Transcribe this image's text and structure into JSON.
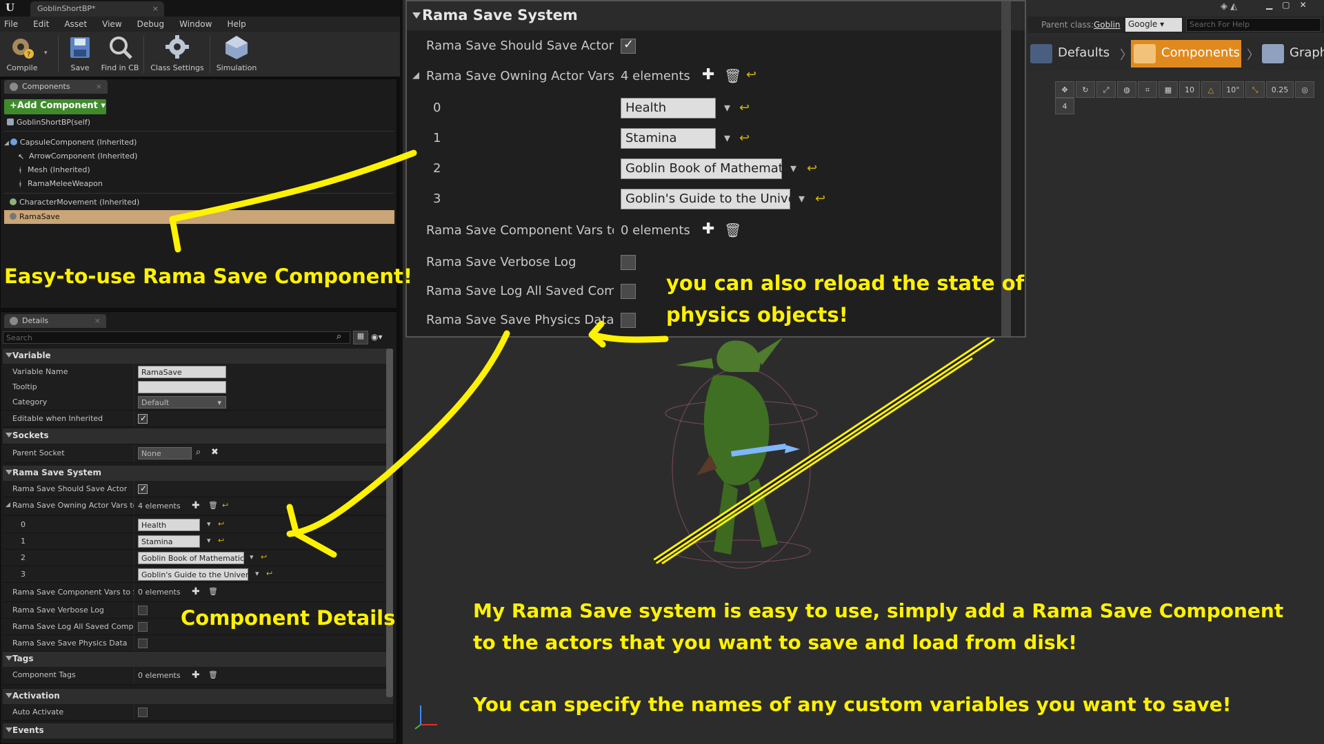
{
  "window": {
    "tab_title": "GoblinShortBP*",
    "logo": "U"
  },
  "menu": [
    "File",
    "Edit",
    "Asset",
    "View",
    "Debug",
    "Window",
    "Help"
  ],
  "toolbar": [
    {
      "label": "Compile",
      "icon": "compile-icon"
    },
    {
      "label": "Save",
      "icon": "save-icon"
    },
    {
      "label": "Find in CB",
      "icon": "find-icon"
    },
    {
      "label": "Class Settings",
      "icon": "gear-icon"
    },
    {
      "label": "Simulation",
      "icon": "simulation-icon"
    }
  ],
  "components_panel": {
    "tab": "Components",
    "add_button": "+Add Component ▾",
    "self": "GoblinShortBP(self)",
    "tree": [
      {
        "label": "CapsuleComponent (Inherited)",
        "indent": 0
      },
      {
        "label": "ArrowComponent (Inherited)",
        "indent": 1
      },
      {
        "label": "Mesh (Inherited)",
        "indent": 1
      },
      {
        "label": "RamaMeleeWeapon",
        "indent": 1
      },
      {
        "label": "CharacterMovement (Inherited)",
        "indent": 0
      },
      {
        "label": "RamaSave",
        "indent": 0,
        "selected": true
      }
    ]
  },
  "details_panel": {
    "tab": "Details",
    "search_placeholder": "Search",
    "variable": {
      "header": "Variable",
      "name_label": "Variable Name",
      "name_value": "RamaSave",
      "tooltip_label": "Tooltip",
      "tooltip_value": "",
      "category_label": "Category",
      "category_value": "Default",
      "editable_label": "Editable when Inherited",
      "editable_checked": true
    },
    "sockets": {
      "header": "Sockets",
      "parent_label": "Parent Socket",
      "parent_value": "None"
    },
    "rama": {
      "header": "Rama Save System",
      "should_save_label": "Rama Save Should Save Actor",
      "should_save": true,
      "owning_label": "Rama Save Owning Actor Vars to S",
      "owning_count": "4 elements",
      "elements": [
        {
          "index": "0",
          "value": "Health"
        },
        {
          "index": "1",
          "value": "Stamina"
        },
        {
          "index": "2",
          "value": "Goblin Book of Mathematics"
        },
        {
          "index": "3",
          "value": "Goblin's Guide to the Universe"
        }
      ],
      "comp_vars_label": "Rama Save Component Vars to Sa",
      "comp_vars_count": "0 elements",
      "verbose_label": "Rama Save Verbose Log",
      "logall_label": "Rama Save Log All Saved Compone",
      "physics_label": "Rama Save Save Physics Data"
    },
    "tags": {
      "header": "Tags",
      "label": "Component Tags",
      "count": "0 elements"
    },
    "activation": {
      "header": "Activation",
      "label": "Auto Activate"
    },
    "events": {
      "header": "Events"
    }
  },
  "zoom_panel": {
    "title": "Rama Save System",
    "should_save_label": "Rama Save Should Save Actor",
    "owning_label": "Rama Save Owning Actor Vars to S",
    "owning_count": "4 elements",
    "elements": [
      {
        "index": "0",
        "value": "Health"
      },
      {
        "index": "1",
        "value": "Stamina"
      },
      {
        "index": "2",
        "value": "Goblin Book of Mathematics"
      },
      {
        "index": "3",
        "value": "Goblin's Guide to the Universe"
      }
    ],
    "comp_vars_label": "Rama Save Component Vars to Sav",
    "comp_vars_count": "0 elements",
    "verbose_label": "Rama Save Verbose Log",
    "logall_label": "Rama Save Log All Saved Compone",
    "physics_label": "Rama Save Save Physics Data"
  },
  "top_right": {
    "parent_label": "Parent class:",
    "parent_value": "Goblin",
    "search_engine": "Google ▾",
    "help_placeholder": "Search For Help"
  },
  "modes": [
    "Defaults",
    "Components",
    "Graph"
  ],
  "viewport_tools": [
    "10",
    "10°",
    "0.25",
    "4"
  ],
  "annotations": {
    "component": "Easy-to-use Rama Save Component!",
    "details": "Component Details",
    "physics_line1": "you can also reload the state of",
    "physics_line2": "physics objects!",
    "main_line1": "My Rama Save system is easy to use, simply add a Rama Save Component",
    "main_line2": "to the actors that you want to save and load from disk!",
    "main_line3": "You can specify the names of any custom variables you want to save!"
  },
  "colors": {
    "accent": "#e08a1e",
    "annotation": "#fff200",
    "add_button": "#3f8b2c",
    "selection": "#c9a577"
  }
}
